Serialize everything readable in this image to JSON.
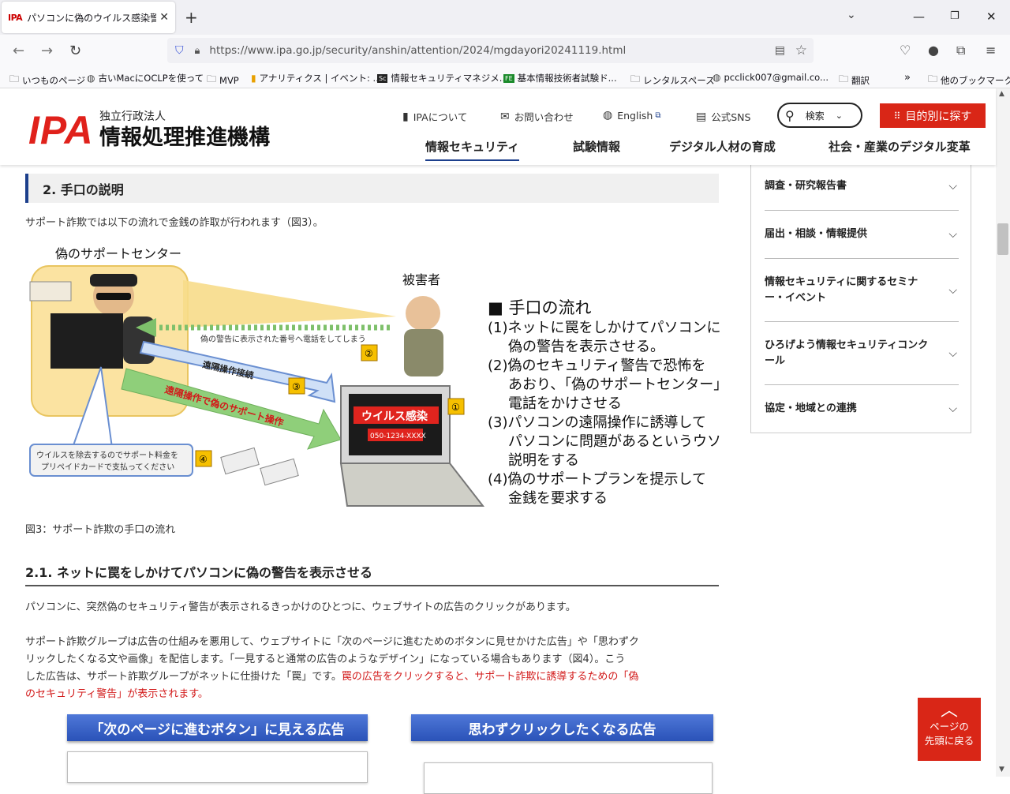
{
  "browser": {
    "tab_favicon": "IPA",
    "tab_title": "パソコンに偽のウイルス感染警告を表示",
    "url_host": "https://www.ipa.go.jp",
    "url_path": "/security/anshin/attention/2024/mgdayori20241119.html",
    "bookmarks": [
      {
        "icon": "folder-icon",
        "label": "いつものページ"
      },
      {
        "icon": "globe-icon",
        "label": "古いMacにOCLPを使って"
      },
      {
        "icon": "folder-icon",
        "label": "MVP"
      },
      {
        "icon": "analytics-icon",
        "label": "アナリティクス | イベント: ..."
      },
      {
        "icon": "sc-icon",
        "label": "情報セキュリティマネジメ..."
      },
      {
        "icon": "fe-icon",
        "label": "基本情報技術者試験ド..."
      },
      {
        "icon": "folder-icon",
        "label": "レンタルスペース"
      },
      {
        "icon": "globe-icon",
        "label": "pcclick007@gmail.co..."
      },
      {
        "icon": "folder-icon",
        "label": "翻訳"
      }
    ],
    "other_bookmarks": "他のブックマーク"
  },
  "site": {
    "logo": "IPA",
    "org_type": "独立行政法人",
    "org_name": "情報処理推進機構",
    "links": {
      "about": "IPAについて",
      "contact": "お問い合わせ",
      "english": "English",
      "sns": "公式SNS"
    },
    "search_label": "検索",
    "purpose_button": "目的別に探す",
    "gnav": [
      "情報セキュリティ",
      "試験情報",
      "デジタル人材の育成",
      "社会・産業のデジタル変革"
    ]
  },
  "article": {
    "section_title": "2. 手口の説明",
    "intro": "サポート詐欺では以下の流れで金銭の詐取が行われます（図3）。",
    "figure": {
      "fake_center": "偽のサポートセンター",
      "victim": "被害者",
      "call_text": "偽の警告に表示された番号へ電話をしてしまう",
      "remote_connect": "遠隔操作接続",
      "remote_op": "遠隔操作で偽のサポート操作",
      "virus_label": "ウイルス感染",
      "phone_no": "050-1234-XXXX",
      "payment_line1": "ウイルスを除去するのでサポート料金を",
      "payment_line2": "プリペイドカードで支払ってください",
      "flow_title": "■ 手口の流れ",
      "steps": [
        "(1)ネットに罠をしかけてパソコンに",
        "偽の警告を表示させる。",
        "(2)偽のセキュリティ警告で恐怖を",
        "あおり、「偽のサポートセンター」に",
        "電話をかけさせる",
        "(3)パソコンの遠隔操作に誘導して",
        "パソコンに問題があるというウソの",
        "説明をする",
        "(4)偽のサポートプランを提示して",
        "金銭を要求する"
      ],
      "badges": [
        "①",
        "②",
        "③",
        "④"
      ]
    },
    "caption": "図3：サポート詐欺の手口の流れ",
    "sub_title": "2.1. ネットに罠をしかけてパソコンに偽の警告を表示させる",
    "p1": "パソコンに、突然偽のセキュリティ警告が表示されるきっかけのひとつに、ウェブサイトの広告のクリックがあります。",
    "p2_line1": "サポート詐欺グループは広告の仕組みを悪用して、ウェブサイトに「次のページに進むためのボタンに見せかけた広告」や「思わずク",
    "p2_line2": "リックしたくなる文や画像」を配信します。「一見すると通常の広告のようなデザイン」になっている場合もあります（図4）。こう",
    "p2_line3_a": "した広告は、サポート詐欺グループがネットに仕掛けた「罠」です。",
    "p2_line3_b": "罠の広告をクリックすると、サポート詐欺に誘導するための「偽",
    "p2_line4": "のセキュリティ警告」が表示されます。",
    "ad_left": "「次のページに進むボタン」に見える広告",
    "ad_right": "思わずクリックしたくなる広告"
  },
  "sidenav": [
    "調査・研究報告書",
    "届出・相談・情報提供",
    "情報セキュリティに関するセミナー・イベント",
    "ひろげよう情報セキュリティコンクール",
    "協定・地域との連携"
  ],
  "back_to_top": {
    "line1": "ページの",
    "line2": "先頭に戻る"
  },
  "colors": {
    "brand_red": "#d92617",
    "nav_blue": "#1c3f8c",
    "alert_red": "#d21a1a"
  }
}
